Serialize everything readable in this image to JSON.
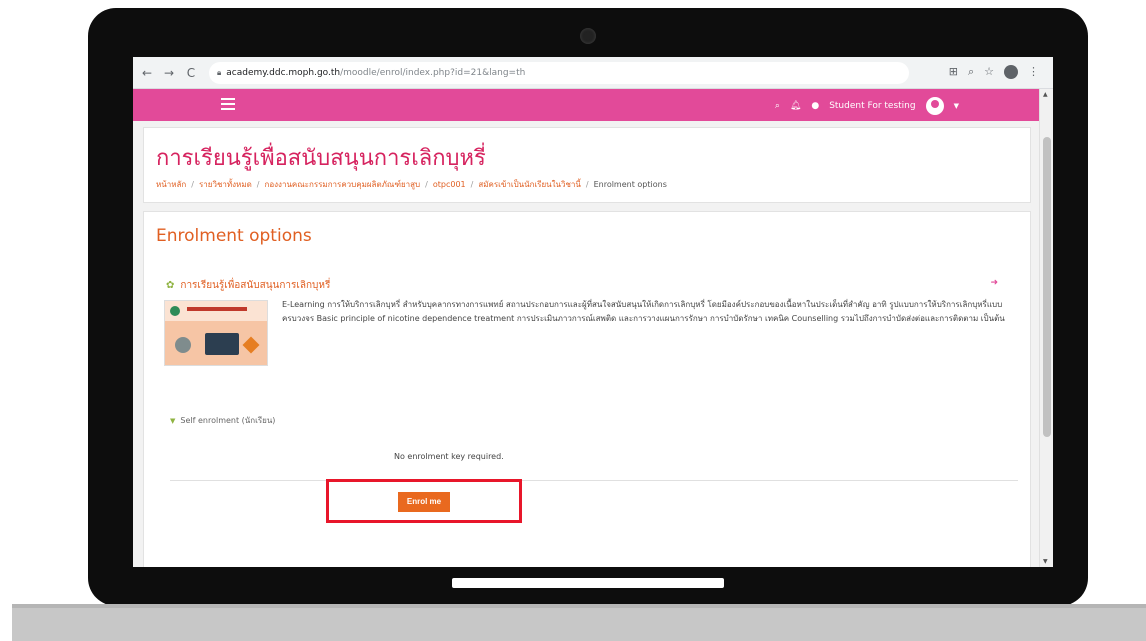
{
  "browser": {
    "url_host": "academy.ddc.moph.go.th",
    "url_path": "/moodle/enrol/index.php?id=21&lang=th"
  },
  "navbar": {
    "user_name": "Student For testing"
  },
  "page": {
    "title": "การเรียนรู้เพื่อสนับสนุนการเลิกบุหรี่",
    "breadcrumb": [
      "หน้าหลัก",
      "รายวิชาทั้งหมด",
      "กองงานคณะกรรมการควบคุมผลิตภัณฑ์ยาสูบ",
      "otpc001",
      "สมัครเข้าเป็นนักเรียนในวิชานี้",
      "Enrolment options"
    ]
  },
  "main": {
    "heading": "Enrolment options",
    "course_name": "การเรียนรู้เพื่อสนับสนุนการเลิกบุหรี่",
    "summary": "E-Learning การให้บริการเลิกบุหรี่ สำหรับบุคลากรทางการแพทย์ สถานประกอบการและผู้ที่สนใจสนับสนุนให้เกิดการเลิกบุหรี่ โดยมีองค์ประกอบของเนื้อหาในประเด็นที่สำคัญ อาทิ รูปแบบการให้บริการเลิกบุหรี่แบบครบวงจร Basic principle of nicotine dependence treatment การประเมินภาวการณ์เสพติด และการวางแผนการรักษา การบำบัดรักษา เทคนิค Counselling รวมไปถึงการบำบัดส่งต่อและการติดตาม เป็นต้น",
    "self_enrolment_label": "Self enrolment (นักเรียน)",
    "no_key_text": "No enrolment key required.",
    "enrol_button": "Enrol me"
  },
  "colors": {
    "navbar": "#e24a99",
    "accent": "#e05f22",
    "title": "#d6235f",
    "enrol_button": "#e9691f",
    "highlight": "#e8162a"
  }
}
